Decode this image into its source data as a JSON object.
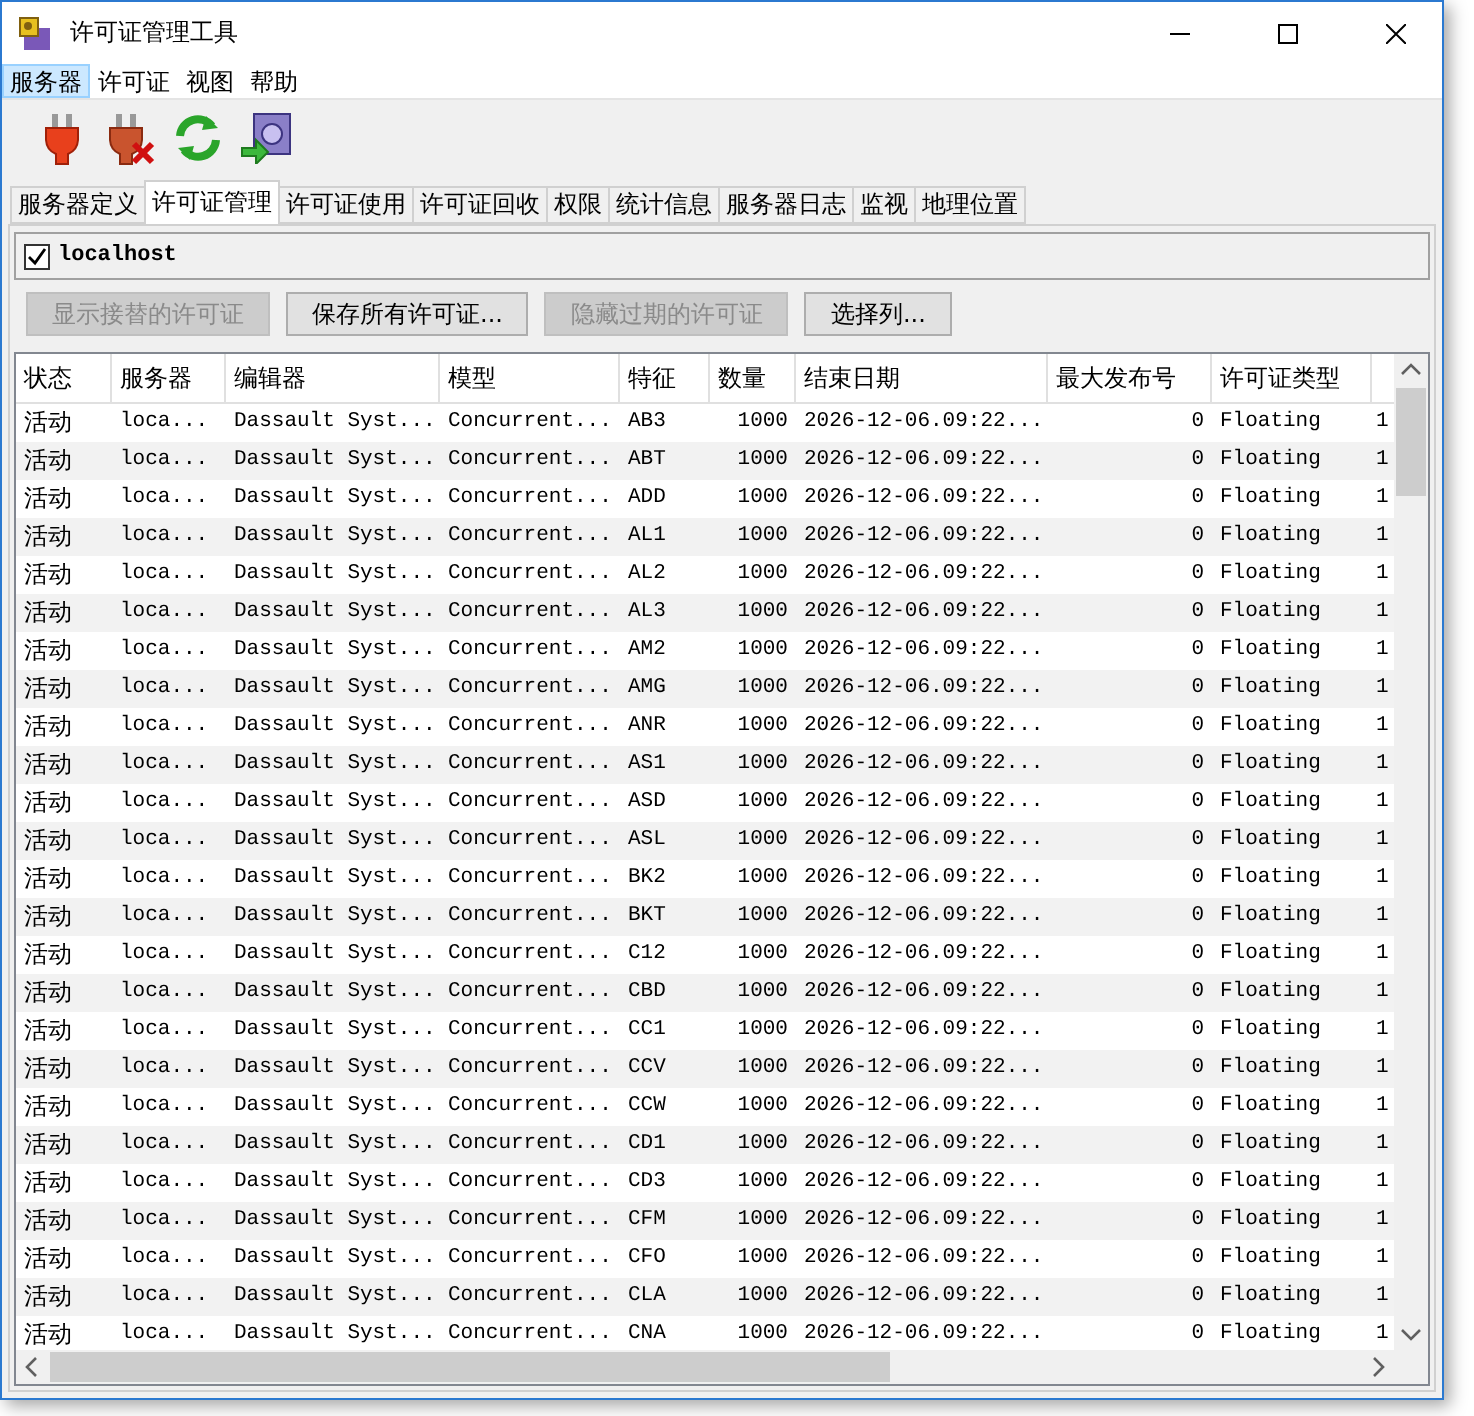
{
  "window": {
    "title": "许可证管理工具"
  },
  "menu": [
    {
      "label": "服务器",
      "selected": true
    },
    {
      "label": "许可证",
      "selected": false
    },
    {
      "label": "视图",
      "selected": false
    },
    {
      "label": "帮助",
      "selected": false
    }
  ],
  "toolbar": [
    {
      "kind": "plug"
    },
    {
      "kind": "unplug"
    },
    {
      "kind": "refresh"
    },
    {
      "kind": "export"
    }
  ],
  "tabs": [
    {
      "label": "服务器定义",
      "selected": false
    },
    {
      "label": "许可证管理",
      "selected": true
    },
    {
      "label": "许可证使用",
      "selected": false
    },
    {
      "label": "许可证回收",
      "selected": false
    },
    {
      "label": "权限",
      "selected": false
    },
    {
      "label": "统计信息",
      "selected": false
    },
    {
      "label": "服务器日志",
      "selected": false
    },
    {
      "label": "监视",
      "selected": false
    },
    {
      "label": "地理位置",
      "selected": false
    }
  ],
  "server": {
    "label": "localhost",
    "checked": true
  },
  "buttons": [
    {
      "label": "显示接替的许可证",
      "disabled": true
    },
    {
      "label": "保存所有许可证...",
      "disabled": false
    },
    {
      "label": "隐藏过期的许可证",
      "disabled": true
    },
    {
      "label": "选择列...",
      "disabled": false
    }
  ],
  "table": {
    "columns": [
      "状态",
      "服务器",
      "编辑器",
      "模型",
      "特征",
      "数量",
      "结束日期",
      "最大发布号",
      "许可证类型"
    ],
    "rows": [
      [
        "活动",
        "loca...",
        "Dassault Syst...",
        "Concurrent...",
        "AB3",
        "1000",
        "2026-12-06.09:22...",
        "0",
        "Floating",
        "1"
      ],
      [
        "活动",
        "loca...",
        "Dassault Syst...",
        "Concurrent...",
        "ABT",
        "1000",
        "2026-12-06.09:22...",
        "0",
        "Floating",
        "1"
      ],
      [
        "活动",
        "loca...",
        "Dassault Syst...",
        "Concurrent...",
        "ADD",
        "1000",
        "2026-12-06.09:22...",
        "0",
        "Floating",
        "1"
      ],
      [
        "活动",
        "loca...",
        "Dassault Syst...",
        "Concurrent...",
        "AL1",
        "1000",
        "2026-12-06.09:22...",
        "0",
        "Floating",
        "1"
      ],
      [
        "活动",
        "loca...",
        "Dassault Syst...",
        "Concurrent...",
        "AL2",
        "1000",
        "2026-12-06.09:22...",
        "0",
        "Floating",
        "1"
      ],
      [
        "活动",
        "loca...",
        "Dassault Syst...",
        "Concurrent...",
        "AL3",
        "1000",
        "2026-12-06.09:22...",
        "0",
        "Floating",
        "1"
      ],
      [
        "活动",
        "loca...",
        "Dassault Syst...",
        "Concurrent...",
        "AM2",
        "1000",
        "2026-12-06.09:22...",
        "0",
        "Floating",
        "1"
      ],
      [
        "活动",
        "loca...",
        "Dassault Syst...",
        "Concurrent...",
        "AMG",
        "1000",
        "2026-12-06.09:22...",
        "0",
        "Floating",
        "1"
      ],
      [
        "活动",
        "loca...",
        "Dassault Syst...",
        "Concurrent...",
        "ANR",
        "1000",
        "2026-12-06.09:22...",
        "0",
        "Floating",
        "1"
      ],
      [
        "活动",
        "loca...",
        "Dassault Syst...",
        "Concurrent...",
        "AS1",
        "1000",
        "2026-12-06.09:22...",
        "0",
        "Floating",
        "1"
      ],
      [
        "活动",
        "loca...",
        "Dassault Syst...",
        "Concurrent...",
        "ASD",
        "1000",
        "2026-12-06.09:22...",
        "0",
        "Floating",
        "1"
      ],
      [
        "活动",
        "loca...",
        "Dassault Syst...",
        "Concurrent...",
        "ASL",
        "1000",
        "2026-12-06.09:22...",
        "0",
        "Floating",
        "1"
      ],
      [
        "活动",
        "loca...",
        "Dassault Syst...",
        "Concurrent...",
        "BK2",
        "1000",
        "2026-12-06.09:22...",
        "0",
        "Floating",
        "1"
      ],
      [
        "活动",
        "loca...",
        "Dassault Syst...",
        "Concurrent...",
        "BKT",
        "1000",
        "2026-12-06.09:22...",
        "0",
        "Floating",
        "1"
      ],
      [
        "活动",
        "loca...",
        "Dassault Syst...",
        "Concurrent...",
        "C12",
        "1000",
        "2026-12-06.09:22...",
        "0",
        "Floating",
        "1"
      ],
      [
        "活动",
        "loca...",
        "Dassault Syst...",
        "Concurrent...",
        "CBD",
        "1000",
        "2026-12-06.09:22...",
        "0",
        "Floating",
        "1"
      ],
      [
        "活动",
        "loca...",
        "Dassault Syst...",
        "Concurrent...",
        "CC1",
        "1000",
        "2026-12-06.09:22...",
        "0",
        "Floating",
        "1"
      ],
      [
        "活动",
        "loca...",
        "Dassault Syst...",
        "Concurrent...",
        "CCV",
        "1000",
        "2026-12-06.09:22...",
        "0",
        "Floating",
        "1"
      ],
      [
        "活动",
        "loca...",
        "Dassault Syst...",
        "Concurrent...",
        "CCW",
        "1000",
        "2026-12-06.09:22...",
        "0",
        "Floating",
        "1"
      ],
      [
        "活动",
        "loca...",
        "Dassault Syst...",
        "Concurrent...",
        "CD1",
        "1000",
        "2026-12-06.09:22...",
        "0",
        "Floating",
        "1"
      ],
      [
        "活动",
        "loca...",
        "Dassault Syst...",
        "Concurrent...",
        "CD3",
        "1000",
        "2026-12-06.09:22...",
        "0",
        "Floating",
        "1"
      ],
      [
        "活动",
        "loca...",
        "Dassault Syst...",
        "Concurrent...",
        "CFM",
        "1000",
        "2026-12-06.09:22...",
        "0",
        "Floating",
        "1"
      ],
      [
        "活动",
        "loca...",
        "Dassault Syst...",
        "Concurrent...",
        "CFO",
        "1000",
        "2026-12-06.09:22...",
        "0",
        "Floating",
        "1"
      ],
      [
        "活动",
        "loca...",
        "Dassault Syst...",
        "Concurrent...",
        "CLA",
        "1000",
        "2026-12-06.09:22...",
        "0",
        "Floating",
        "1"
      ],
      [
        "活动",
        "loca...",
        "Dassault Syst...",
        "Concurrent...",
        "CNA",
        "1000",
        "2026-12-06.09:22...",
        "0",
        "Floating",
        "1"
      ]
    ]
  }
}
